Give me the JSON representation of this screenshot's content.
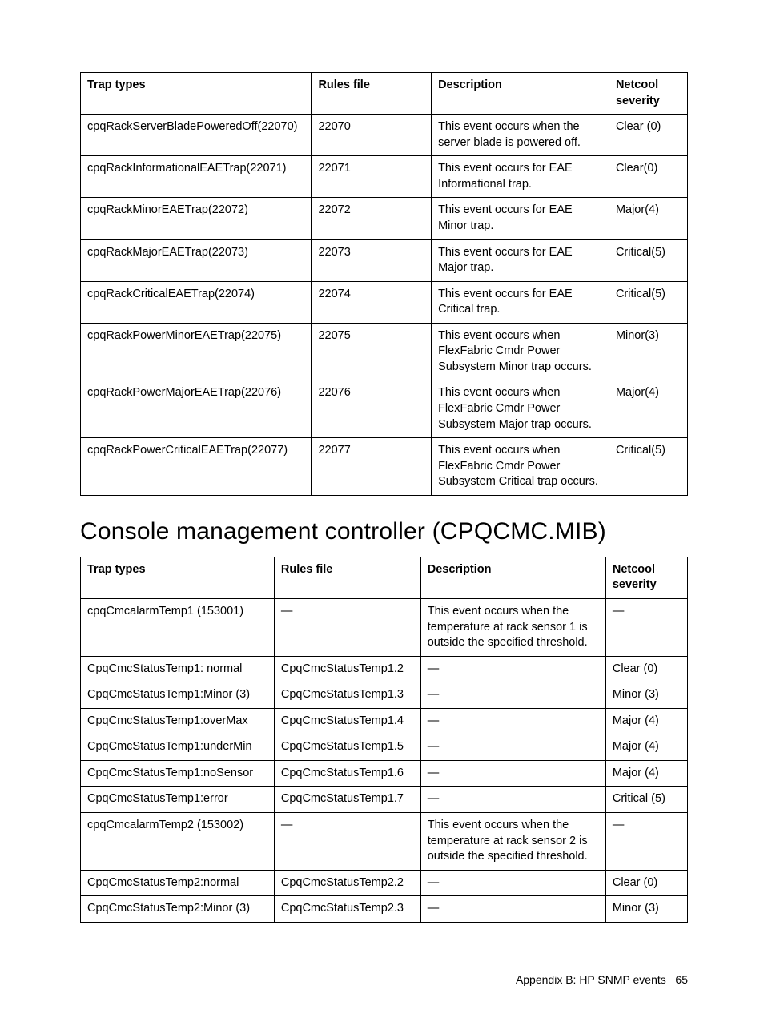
{
  "table1": {
    "headers": {
      "trap": "Trap types",
      "rules": "Rules file",
      "desc": "Description",
      "sev": "Netcool severity"
    },
    "rows": [
      {
        "trap": "cpqRackServerBladePoweredOff(22070)",
        "rules": "22070",
        "desc": "This event occurs when the server blade is powered off.",
        "sev": "Clear (0)"
      },
      {
        "trap": "cpqRackInformationalEAETrap(22071)",
        "rules": "22071",
        "desc": "This event occurs for EAE Informational trap.",
        "sev": "Clear(0)"
      },
      {
        "trap": "cpqRackMinorEAETrap(22072)",
        "rules": "22072",
        "desc": "This event occurs for EAE Minor trap.",
        "sev": "Major(4)"
      },
      {
        "trap": "cpqRackMajorEAETrap(22073)",
        "rules": "22073",
        "desc": "This event occurs for EAE Major trap.",
        "sev": "Critical(5)"
      },
      {
        "trap": "cpqRackCriticalEAETrap(22074)",
        "rules": "22074",
        "desc": "This event occurs for EAE Critical trap.",
        "sev": "Critical(5)"
      },
      {
        "trap": "cpqRackPowerMinorEAETrap(22075)",
        "rules": "22075",
        "desc": "This event occurs when FlexFabric Cmdr Power Subsystem Minor trap occurs.",
        "sev": "Minor(3)"
      },
      {
        "trap": "cpqRackPowerMajorEAETrap(22076)",
        "rules": "22076",
        "desc": "This event occurs when FlexFabric Cmdr Power Subsystem Major trap occurs.",
        "sev": "Major(4)"
      },
      {
        "trap": "cpqRackPowerCriticalEAETrap(22077)",
        "rules": "22077",
        "desc": "This event occurs when FlexFabric Cmdr Power Subsystem Critical trap occurs.",
        "sev": "Critical(5)"
      }
    ]
  },
  "section_heading": "Console management controller (CPQCMC.MIB)",
  "table2": {
    "headers": {
      "trap": "Trap types",
      "rules": "Rules file",
      "desc": "Description",
      "sev": "Netcool severity"
    },
    "rows": [
      {
        "trap": "cpqCmcalarmTemp1 (153001)",
        "rules": "—",
        "desc": "This event occurs when the temperature at rack sensor 1 is outside the specified threshold.",
        "sev": "—"
      },
      {
        "trap": "CpqCmcStatusTemp1: normal",
        "rules": "CpqCmcStatusTemp1.2",
        "desc": "—",
        "sev": "Clear (0)"
      },
      {
        "trap": "CpqCmcStatusTemp1:Minor (3)",
        "rules": "CpqCmcStatusTemp1.3",
        "desc": "—",
        "sev": "Minor (3)"
      },
      {
        "trap": "CpqCmcStatusTemp1:overMax",
        "rules": "CpqCmcStatusTemp1.4",
        "desc": "—",
        "sev": "Major (4)"
      },
      {
        "trap": "CpqCmcStatusTemp1:underMin",
        "rules": "CpqCmcStatusTemp1.5",
        "desc": "—",
        "sev": "Major (4)"
      },
      {
        "trap": "CpqCmcStatusTemp1:noSensor",
        "rules": "CpqCmcStatusTemp1.6",
        "desc": "—",
        "sev": "Major (4)"
      },
      {
        "trap": "CpqCmcStatusTemp1:error",
        "rules": "CpqCmcStatusTemp1.7",
        "desc": "—",
        "sev": "Critical (5)"
      },
      {
        "trap": "cpqCmcalarmTemp2 (153002)",
        "rules": "—",
        "desc": "This event occurs when the temperature at rack sensor 2 is outside the specified threshold.",
        "sev": "—"
      },
      {
        "trap": "CpqCmcStatusTemp2:normal",
        "rules": "CpqCmcStatusTemp2.2",
        "desc": "—",
        "sev": "Clear (0)"
      },
      {
        "trap": "CpqCmcStatusTemp2:Minor (3)",
        "rules": "CpqCmcStatusTemp2.3",
        "desc": "—",
        "sev": "Minor (3)"
      }
    ]
  },
  "footer": {
    "text": "Appendix B: HP SNMP events",
    "page": "65"
  }
}
